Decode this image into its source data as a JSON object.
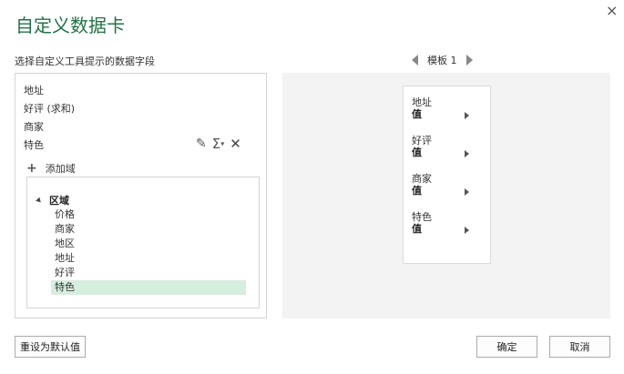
{
  "dialog": {
    "title": "自定义数据卡",
    "close_glyph": "×"
  },
  "left": {
    "instruction": "选择自定义工具提示的数据字段",
    "fields": [
      "地址",
      "好评 (求和)",
      "商家",
      "特色"
    ],
    "tools": {
      "edit_glyph": "✎",
      "sigma_glyph": "Σ",
      "sigma_caret": "▾",
      "remove_glyph": "✕"
    },
    "add_field_plus": "+",
    "add_field_label": "添加域",
    "tree": {
      "root_label": "区域",
      "children": [
        "价格",
        "商家",
        "地区",
        "地址",
        "好评",
        "特色"
      ],
      "selected_index": 5
    }
  },
  "template_nav": {
    "label": "模板 1"
  },
  "card": {
    "fields": [
      {
        "label": "地址",
        "value": "值"
      },
      {
        "label": "好评",
        "value": "值"
      },
      {
        "label": "商家",
        "value": "值"
      },
      {
        "label": "特色",
        "value": "值"
      }
    ]
  },
  "buttons": {
    "reset": "重设为默认值",
    "ok": "确定",
    "cancel": "取消"
  },
  "colors": {
    "title": "#217346",
    "selected_row": "#d6eedf",
    "preview_bg": "#f3f3f3"
  }
}
